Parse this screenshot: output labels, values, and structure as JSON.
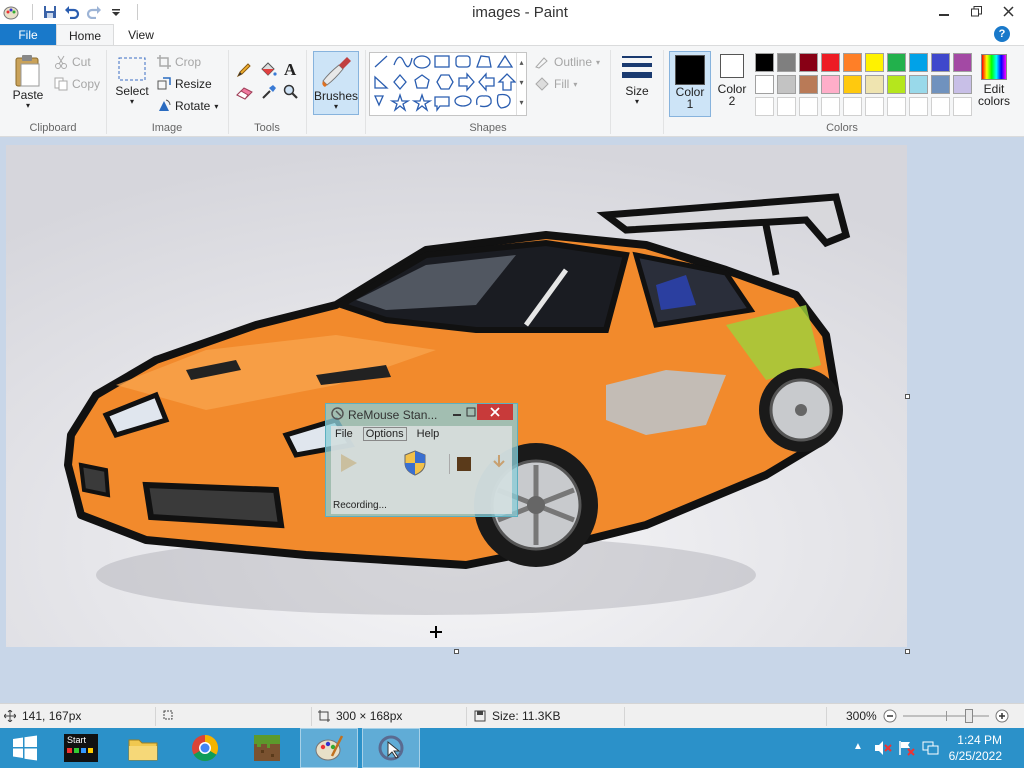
{
  "window": {
    "title": "images - Paint"
  },
  "tabs": {
    "file": "File",
    "home": "Home",
    "view": "View"
  },
  "ribbon": {
    "clipboard": {
      "paste": "Paste",
      "cut": "Cut",
      "copy": "Copy",
      "label": "Clipboard"
    },
    "image": {
      "select": "Select",
      "crop": "Crop",
      "resize": "Resize",
      "rotate": "Rotate",
      "label": "Image"
    },
    "tools": {
      "label": "Tools"
    },
    "brushes": {
      "label": "Brushes"
    },
    "shapes": {
      "outline": "Outline",
      "fill": "Fill",
      "label": "Shapes"
    },
    "size": {
      "label": "Size"
    },
    "colors": {
      "color1": "Color",
      "color1_num": "1",
      "color2": "Color",
      "color2_num": "2",
      "edit": "Edit",
      "edit2": "colors",
      "label": "Colors",
      "color1_value": "#000000",
      "color2_value": "#ffffff",
      "palette_row1": [
        "#000000",
        "#7f7f7f",
        "#880015",
        "#ed1c24",
        "#ff7f27",
        "#fff200",
        "#22b14c",
        "#00a2e8",
        "#3f48cc",
        "#a349a4"
      ],
      "palette_row2": [
        "#ffffff",
        "#c3c3c3",
        "#b97a57",
        "#ffaec9",
        "#ffc90e",
        "#efe4b0",
        "#b5e61d",
        "#99d9ea",
        "#7092be",
        "#c8bfe7"
      ]
    }
  },
  "remouse": {
    "title": "ReMouse Stan...",
    "menu": {
      "file": "File",
      "options": "Options",
      "help": "Help"
    },
    "status": "Recording..."
  },
  "statusbar": {
    "cursor": "141, 167px",
    "dimensions": "300 × 168px",
    "size": "Size: 11.3KB",
    "zoom": "300%"
  },
  "taskbar": {
    "start_label": "Start",
    "time": "1:24 PM",
    "date": "6/25/2022"
  }
}
